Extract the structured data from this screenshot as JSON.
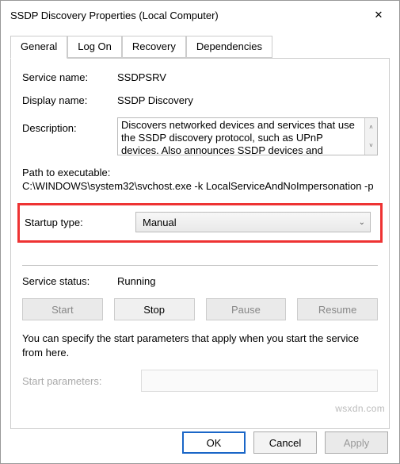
{
  "window": {
    "title": "SSDP Discovery Properties (Local Computer)"
  },
  "tabs": {
    "general": "General",
    "logon": "Log On",
    "recovery": "Recovery",
    "dependencies": "Dependencies"
  },
  "general": {
    "service_name_label": "Service name:",
    "service_name_value": "SSDPSRV",
    "display_name_label": "Display name:",
    "display_name_value": "SSDP Discovery",
    "description_label": "Description:",
    "description_value": "Discovers networked devices and services that use the SSDP discovery protocol, such as UPnP devices. Also announces SSDP devices and services running",
    "path_label": "Path to executable:",
    "path_value": "C:\\WINDOWS\\system32\\svchost.exe -k LocalServiceAndNoImpersonation -p",
    "startup_type_label": "Startup type:",
    "startup_type_value": "Manual",
    "service_status_label": "Service status:",
    "service_status_value": "Running",
    "buttons": {
      "start": "Start",
      "stop": "Stop",
      "pause": "Pause",
      "resume": "Resume"
    },
    "hint": "You can specify the start parameters that apply when you start the service from here.",
    "start_params_label": "Start parameters:",
    "start_params_value": ""
  },
  "footer": {
    "ok": "OK",
    "cancel": "Cancel",
    "apply": "Apply"
  },
  "watermark": "wsxdn.com"
}
